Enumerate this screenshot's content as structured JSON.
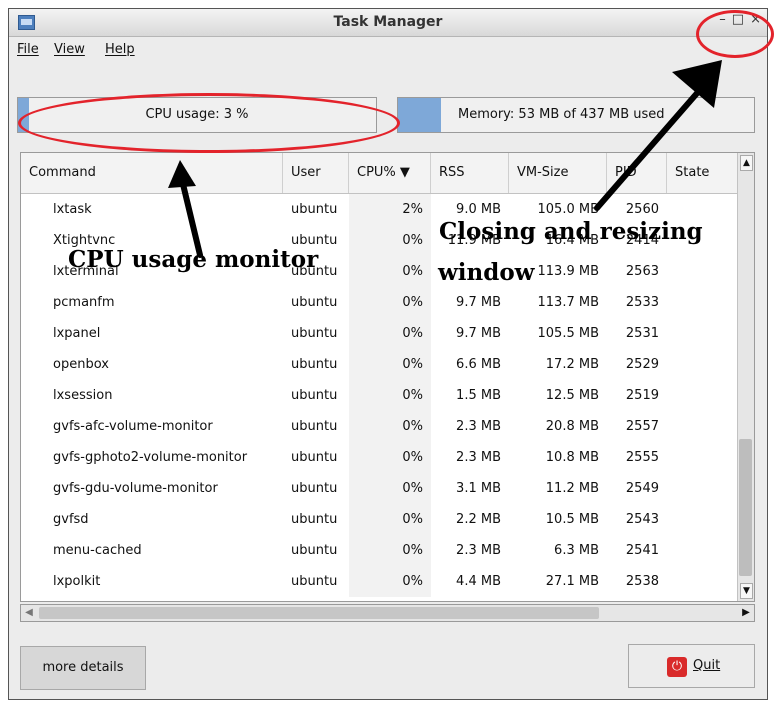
{
  "window": {
    "title": "Task Manager",
    "controls": {
      "minimize": "–",
      "maximize": "□",
      "close": "×"
    }
  },
  "menu": [
    {
      "label": "File"
    },
    {
      "label": "View"
    },
    {
      "label": "Help"
    }
  ],
  "cpu": {
    "label": "CPU usage: 3 %",
    "percent": 3
  },
  "memory": {
    "label": "Memory: 53 MB of 437 MB used",
    "used_mb": 53,
    "total_mb": 437
  },
  "table": {
    "columns": [
      "Command",
      "User",
      "CPU% ▼",
      "RSS",
      "VM-Size",
      "PID",
      "State"
    ],
    "rows": [
      {
        "command": "lxtask",
        "user": "ubuntu",
        "cpu": "2%",
        "rss": "9.0 MB",
        "vm": "105.0 MB",
        "pid": "2560",
        "state": ""
      },
      {
        "command": "Xtightvnc",
        "user": "ubuntu",
        "cpu": "0%",
        "rss": "11.9 MB",
        "vm": "16.4 MB",
        "pid": "2414",
        "state": ""
      },
      {
        "command": "lxterminal",
        "user": "ubuntu",
        "cpu": "0%",
        "rss": "",
        "vm": "113.9 MB",
        "pid": "2563",
        "state": ""
      },
      {
        "command": "pcmanfm",
        "user": "ubuntu",
        "cpu": "0%",
        "rss": "9.7 MB",
        "vm": "113.7 MB",
        "pid": "2533",
        "state": ""
      },
      {
        "command": "lxpanel",
        "user": "ubuntu",
        "cpu": "0%",
        "rss": "9.7 MB",
        "vm": "105.5 MB",
        "pid": "2531",
        "state": ""
      },
      {
        "command": "openbox",
        "user": "ubuntu",
        "cpu": "0%",
        "rss": "6.6 MB",
        "vm": "17.2 MB",
        "pid": "2529",
        "state": ""
      },
      {
        "command": "lxsession",
        "user": "ubuntu",
        "cpu": "0%",
        "rss": "1.5 MB",
        "vm": "12.5 MB",
        "pid": "2519",
        "state": ""
      },
      {
        "command": "gvfs-afc-volume-monitor",
        "user": "ubuntu",
        "cpu": "0%",
        "rss": "2.3 MB",
        "vm": "20.8 MB",
        "pid": "2557",
        "state": ""
      },
      {
        "command": "gvfs-gphoto2-volume-monitor",
        "user": "ubuntu",
        "cpu": "0%",
        "rss": "2.3 MB",
        "vm": "10.8 MB",
        "pid": "2555",
        "state": ""
      },
      {
        "command": "gvfs-gdu-volume-monitor",
        "user": "ubuntu",
        "cpu": "0%",
        "rss": "3.1 MB",
        "vm": "11.2 MB",
        "pid": "2549",
        "state": ""
      },
      {
        "command": "gvfsd",
        "user": "ubuntu",
        "cpu": "0%",
        "rss": "2.2 MB",
        "vm": "10.5 MB",
        "pid": "2543",
        "state": ""
      },
      {
        "command": "menu-cached",
        "user": "ubuntu",
        "cpu": "0%",
        "rss": "2.3 MB",
        "vm": "6.3 MB",
        "pid": "2541",
        "state": ""
      },
      {
        "command": "lxpolkit",
        "user": "ubuntu",
        "cpu": "0%",
        "rss": "4.4 MB",
        "vm": "27.1 MB",
        "pid": "2538",
        "state": ""
      }
    ]
  },
  "buttons": {
    "more_details": "more details",
    "quit": "Quit"
  },
  "annotations": {
    "cpu_text": "CPU usage monitor",
    "window_text_line1": "Closing and resizing",
    "window_text_line2": "window",
    "color": "#e3232b"
  },
  "icons": {
    "app": "task-manager-icon",
    "quit": "power-icon",
    "sort": "sort-down-icon"
  }
}
